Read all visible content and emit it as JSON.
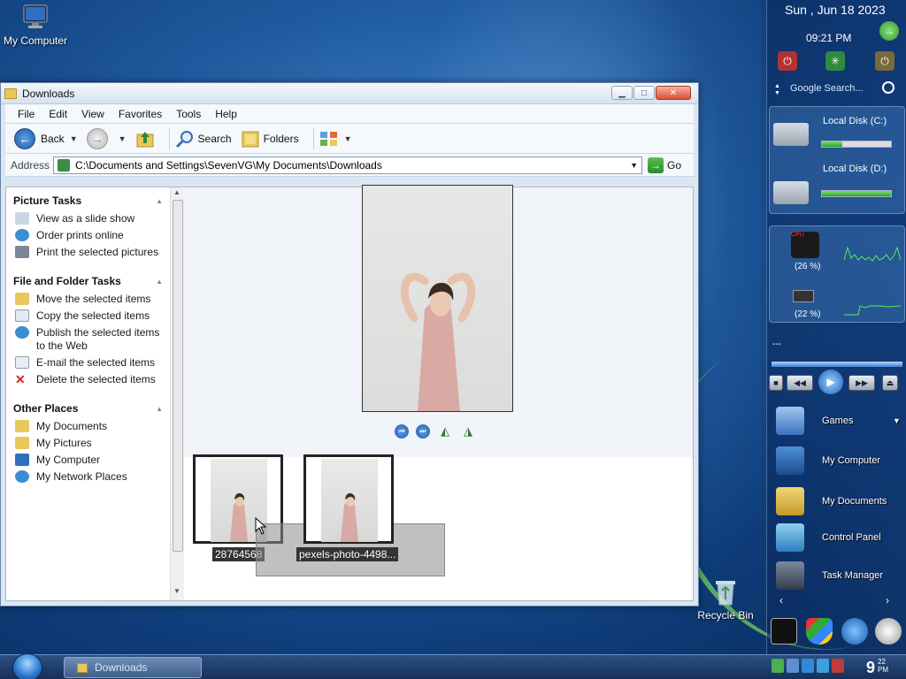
{
  "desktop": {
    "icons": [
      {
        "label": "My Computer"
      },
      {
        "label": "Recycle Bin"
      }
    ]
  },
  "window": {
    "title": "Downloads",
    "controls": {
      "minimize": "▁",
      "maximize": "□",
      "close": "✕"
    },
    "menu": [
      "File",
      "Edit",
      "View",
      "Favorites",
      "Tools",
      "Help"
    ],
    "toolbar": {
      "back": "Back",
      "search": "Search",
      "folders": "Folders"
    },
    "address": {
      "label": "Address",
      "value": "C:\\Documents and Settings\\SevenVG\\My Documents\\Downloads",
      "go": "Go"
    },
    "tasks": {
      "picture": {
        "title": "Picture Tasks",
        "items": [
          "View as a slide show",
          "Order prints online",
          "Print the selected pictures"
        ]
      },
      "file_folder": {
        "title": "File and Folder Tasks",
        "items": [
          "Move the selected items",
          "Copy the selected items",
          "Publish the selected items to the Web",
          "E-mail the selected items",
          "Delete the selected items"
        ]
      },
      "other": {
        "title": "Other Places",
        "items": [
          "My Documents",
          "My Pictures",
          "My Computer",
          "My Network Places"
        ]
      }
    },
    "thumbnails": [
      {
        "label": "28764568"
      },
      {
        "label": "pexels-photo-4498..."
      }
    ]
  },
  "sidebar": {
    "date": "Sun , Jun 18 2023",
    "time": "09:21 PM",
    "search_placeholder": "Google Search...",
    "disks": [
      {
        "label": "Local Disk (C:)",
        "used_fraction": 0.3
      },
      {
        "label": "Local Disk (D:)",
        "used_fraction": 1.0
      }
    ],
    "cpu": {
      "percent": "(26 %)"
    },
    "ram": {
      "percent": "(22 %)"
    },
    "media_title": "---",
    "launchers": [
      "Games",
      "My Computer",
      "My Documents",
      "Control Panel",
      "Task Manager"
    ]
  },
  "taskbar": {
    "task": "Downloads",
    "clock_hour": "9",
    "clock_min": "22",
    "clock_ampm": "PM"
  }
}
